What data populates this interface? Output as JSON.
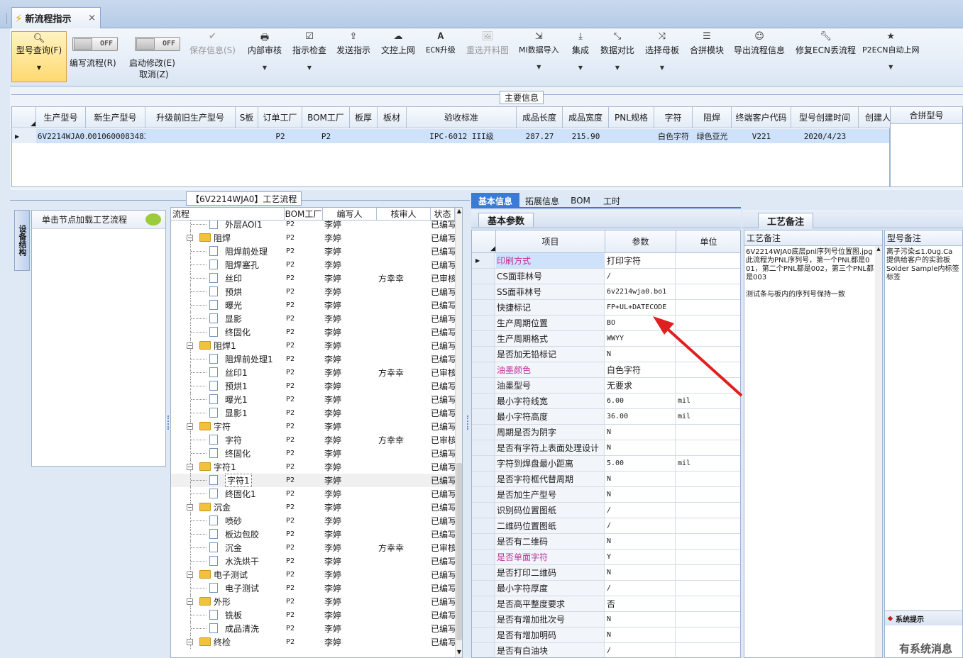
{
  "tab": {
    "title": "新流程指示",
    "close": "×"
  },
  "toolbar": {
    "query": "型号查询(F)",
    "write_flow": "编写流程(R)",
    "toggle1": "OFF",
    "toggle2": "OFF",
    "start_modify": "启动修改(E)",
    "cancel": "取消(Z)",
    "save": "保存信息(S)",
    "internal_review": "内部审核",
    "instruction_check": "指示检查",
    "send": "发送指示",
    "doc_upload": "文控上网",
    "ecn_upgrade": "ECN升级",
    "reselect": "重选开料图",
    "mi_import": "MI数据导入",
    "integrate": "集成",
    "compare": "数据对比",
    "select_mother": "选择母板",
    "merge_module": "合拼模块",
    "export_flow": "导出流程信息",
    "modify_ecn": "修复ECN丢流程",
    "p2ecn": "P2ECN自动上网"
  },
  "main_info": {
    "section_title": "主要信息",
    "headers": [
      "生产型号",
      "新生产型号",
      "升级前旧生产型号",
      "S板",
      "订单工厂",
      "BOM工厂",
      "板厚",
      "板材",
      "验收标准",
      "成品长度",
      "成品宽度",
      "PNL规格",
      "字符",
      "阻焊",
      "终端客户代码",
      "型号创建时间",
      "创建人"
    ],
    "row": [
      "6V2214WJA0",
      "10010600083483",
      "",
      "",
      "P2",
      "P2",
      "",
      "",
      "IPC-6012 III级",
      "287.27",
      "215.90",
      "",
      "白色字符",
      "绿色亚光",
      "V221",
      "2020/4/23",
      ""
    ],
    "merge_header": "合拼型号"
  },
  "side": {
    "vertical_tab": "设备结构",
    "hint": "单击节点加载工艺流程"
  },
  "flow": {
    "title": "【6V2214WJA0】工艺流程",
    "headers": [
      "流程",
      "BOM工厂",
      "编写人",
      "核审人",
      "状态"
    ],
    "rows": [
      {
        "level": 1,
        "type": "doc",
        "name": "外层AOI1",
        "bom": "P2",
        "writer": "李婷",
        "reviewer": "",
        "status": "已编写"
      },
      {
        "level": 0,
        "type": "folder",
        "name": "阻焊",
        "bom": "P2",
        "writer": "李婷",
        "reviewer": "",
        "status": "已编写"
      },
      {
        "level": 1,
        "type": "doc",
        "name": "阻焊前处理",
        "bom": "P2",
        "writer": "李婷",
        "reviewer": "",
        "status": "已编写"
      },
      {
        "level": 1,
        "type": "doc",
        "name": "阻焊塞孔",
        "bom": "P2",
        "writer": "李婷",
        "reviewer": "",
        "status": "已编写"
      },
      {
        "level": 1,
        "type": "doc",
        "name": "丝印",
        "bom": "P2",
        "writer": "李婷",
        "reviewer": "方幸幸",
        "status": "已审核"
      },
      {
        "level": 1,
        "type": "doc",
        "name": "预烘",
        "bom": "P2",
        "writer": "李婷",
        "reviewer": "",
        "status": "已编写"
      },
      {
        "level": 1,
        "type": "doc",
        "name": "曝光",
        "bom": "P2",
        "writer": "李婷",
        "reviewer": "",
        "status": "已编写"
      },
      {
        "level": 1,
        "type": "doc",
        "name": "显影",
        "bom": "P2",
        "writer": "李婷",
        "reviewer": "",
        "status": "已编写"
      },
      {
        "level": 1,
        "type": "doc",
        "name": "终固化",
        "bom": "P2",
        "writer": "李婷",
        "reviewer": "",
        "status": "已编写"
      },
      {
        "level": 0,
        "type": "folder",
        "name": "阻焊1",
        "bom": "P2",
        "writer": "李婷",
        "reviewer": "",
        "status": "已编写"
      },
      {
        "level": 1,
        "type": "doc",
        "name": "阻焊前处理1",
        "bom": "P2",
        "writer": "李婷",
        "reviewer": "",
        "status": "已编写"
      },
      {
        "level": 1,
        "type": "doc",
        "name": "丝印1",
        "bom": "P2",
        "writer": "李婷",
        "reviewer": "方幸幸",
        "status": "已审核"
      },
      {
        "level": 1,
        "type": "doc",
        "name": "预烘1",
        "bom": "P2",
        "writer": "李婷",
        "reviewer": "",
        "status": "已编写"
      },
      {
        "level": 1,
        "type": "doc",
        "name": "曝光1",
        "bom": "P2",
        "writer": "李婷",
        "reviewer": "",
        "status": "已编写"
      },
      {
        "level": 1,
        "type": "doc",
        "name": "显影1",
        "bom": "P2",
        "writer": "李婷",
        "reviewer": "",
        "status": "已编写"
      },
      {
        "level": 0,
        "type": "folder",
        "name": "字符",
        "bom": "P2",
        "writer": "李婷",
        "reviewer": "",
        "status": "已编写"
      },
      {
        "level": 1,
        "type": "doc",
        "name": "字符",
        "bom": "P2",
        "writer": "李婷",
        "reviewer": "方幸幸",
        "status": "已审核"
      },
      {
        "level": 1,
        "type": "doc",
        "name": "终固化",
        "bom": "P2",
        "writer": "李婷",
        "reviewer": "",
        "status": "已编写"
      },
      {
        "level": 0,
        "type": "folder",
        "name": "字符1",
        "bom": "P2",
        "writer": "李婷",
        "reviewer": "",
        "status": "已编写"
      },
      {
        "level": 1,
        "type": "doc",
        "name": "字符1",
        "bom": "P2",
        "writer": "李婷",
        "reviewer": "",
        "status": "已编写",
        "selected": true
      },
      {
        "level": 1,
        "type": "doc",
        "name": "终固化1",
        "bom": "P2",
        "writer": "李婷",
        "reviewer": "",
        "status": "已编写"
      },
      {
        "level": 0,
        "type": "folder",
        "name": "沉金",
        "bom": "P2",
        "writer": "李婷",
        "reviewer": "",
        "status": "已编写"
      },
      {
        "level": 1,
        "type": "doc",
        "name": "喷砂",
        "bom": "P2",
        "writer": "李婷",
        "reviewer": "",
        "status": "已编写"
      },
      {
        "level": 1,
        "type": "doc",
        "name": "板边包胶",
        "bom": "P2",
        "writer": "李婷",
        "reviewer": "",
        "status": "已编写"
      },
      {
        "level": 1,
        "type": "doc",
        "name": "沉金",
        "bom": "P2",
        "writer": "李婷",
        "reviewer": "方幸幸",
        "status": "已审核"
      },
      {
        "level": 1,
        "type": "doc",
        "name": "水洗烘干",
        "bom": "P2",
        "writer": "李婷",
        "reviewer": "",
        "status": "已编写"
      },
      {
        "level": 0,
        "type": "folder",
        "name": "电子测试",
        "bom": "P2",
        "writer": "李婷",
        "reviewer": "",
        "status": "已编写"
      },
      {
        "level": 1,
        "type": "doc",
        "name": "电子测试",
        "bom": "P2",
        "writer": "李婷",
        "reviewer": "",
        "status": "已编写"
      },
      {
        "level": 0,
        "type": "folder",
        "name": "外形",
        "bom": "P2",
        "writer": "李婷",
        "reviewer": "",
        "status": "已编写"
      },
      {
        "level": 1,
        "type": "doc",
        "name": "铣板",
        "bom": "P2",
        "writer": "李婷",
        "reviewer": "",
        "status": "已编写"
      },
      {
        "level": 1,
        "type": "doc",
        "name": "成品清洗",
        "bom": "P2",
        "writer": "李婷",
        "reviewer": "",
        "status": "已编写"
      },
      {
        "level": 0,
        "type": "folder",
        "name": "终检",
        "bom": "P2",
        "writer": "李婷",
        "reviewer": "",
        "status": "已编写"
      }
    ]
  },
  "params": {
    "tabs": [
      "基本信息",
      "拓展信息",
      "BOM",
      "工时"
    ],
    "section": "基本参数",
    "headers": [
      "项目",
      "参数",
      "单位"
    ],
    "rows": [
      {
        "item": "印刷方式",
        "value": "打印字符",
        "unit": "",
        "pink": true,
        "current": true
      },
      {
        "item": "CS面菲林号",
        "value": "/",
        "unit": ""
      },
      {
        "item": "SS面菲林号",
        "value": "6v2214wja0.bo1",
        "unit": ""
      },
      {
        "item": "快捷标记",
        "value": "FP+UL+DATECODE",
        "unit": ""
      },
      {
        "item": "生产周期位置",
        "value": "BO",
        "unit": ""
      },
      {
        "item": "生产周期格式",
        "value": "WWYY",
        "unit": ""
      },
      {
        "item": "是否加无铅标记",
        "value": "N",
        "unit": ""
      },
      {
        "item": "油墨颜色",
        "value": "白色字符",
        "unit": "",
        "pink": true
      },
      {
        "item": "油墨型号",
        "value": "无要求",
        "unit": ""
      },
      {
        "item": "最小字符线宽",
        "value": "6.00",
        "unit": "mil"
      },
      {
        "item": "最小字符高度",
        "value": "36.00",
        "unit": "mil"
      },
      {
        "item": "周期是否为阴字",
        "value": "N",
        "unit": ""
      },
      {
        "item": "是否有字符上表面处理设计",
        "value": "N",
        "unit": ""
      },
      {
        "item": "字符到焊盘最小距离",
        "value": "5.00",
        "unit": "mil"
      },
      {
        "item": "是否字符框代替周期",
        "value": "N",
        "unit": ""
      },
      {
        "item": "是否加生产型号",
        "value": "N",
        "unit": ""
      },
      {
        "item": "识别码位置图纸",
        "value": "/",
        "unit": ""
      },
      {
        "item": "二维码位置图纸",
        "value": "/",
        "unit": ""
      },
      {
        "item": "是否有二维码",
        "value": "N",
        "unit": ""
      },
      {
        "item": "是否单面字符",
        "value": "Y",
        "unit": "",
        "pink": true
      },
      {
        "item": "是否打印二维码",
        "value": "N",
        "unit": ""
      },
      {
        "item": "最小字符厚度",
        "value": "/",
        "unit": ""
      },
      {
        "item": "是否高平整度要求",
        "value": "否",
        "unit": ""
      },
      {
        "item": "是否有增加批次号",
        "value": "N",
        "unit": ""
      },
      {
        "item": "是否有增加明码",
        "value": "N",
        "unit": ""
      },
      {
        "item": "是否有白油块",
        "value": "/",
        "unit": ""
      }
    ]
  },
  "notes": {
    "tab": "工艺备注",
    "col1_header": "工艺备注",
    "col1_text": "6V2214WJA0底层pnl序列号位置图.jpg\n此流程为PNL序列号，第一个PNL都是001，第二个PNL都是002，第三个PNL都是003\n\n测试条与板内的序列号保持一致",
    "col2_header": "型号备注",
    "col2_text": "离子污染≤1.0ug.Ca\n提供给客户的实验板\nSolder Sample内标签\n标签"
  },
  "popup": {
    "title": "系统提示",
    "text": "有系统消息"
  },
  "colors": {
    "accent": "#3a7bd5",
    "pink": "#c0309a",
    "arrow": "#e02020",
    "selection": "#cfe2fb"
  }
}
